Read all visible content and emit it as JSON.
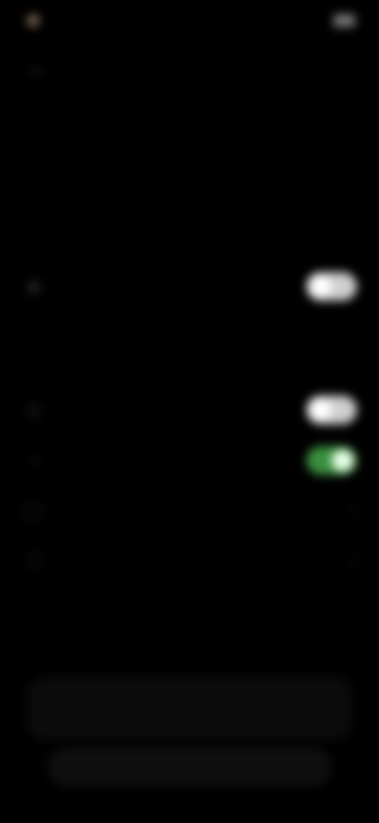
{
  "statusbar": {
    "time": "",
    "battery_text": ""
  },
  "page": {
    "title": ""
  },
  "section_main": {
    "title": "",
    "description": "",
    "toggle_row": {
      "label": "",
      "icon": "person-icon",
      "enabled": true
    }
  },
  "section_list": {
    "title": "",
    "items": [
      {
        "label": "",
        "icon": "eye-icon",
        "control": "toggle",
        "state": "off-white"
      },
      {
        "label": "",
        "icon": "bell-icon",
        "control": "toggle",
        "state": "on"
      },
      {
        "label": "",
        "icon": "clock-icon",
        "control": "chevron"
      },
      {
        "label": "",
        "icon": "info-icon",
        "control": "chevron"
      }
    ]
  },
  "bottom": {
    "primary_label": "",
    "secondary_label": ""
  },
  "colors": {
    "background": "#000000",
    "toggle_on": "#3b8f3f"
  }
}
